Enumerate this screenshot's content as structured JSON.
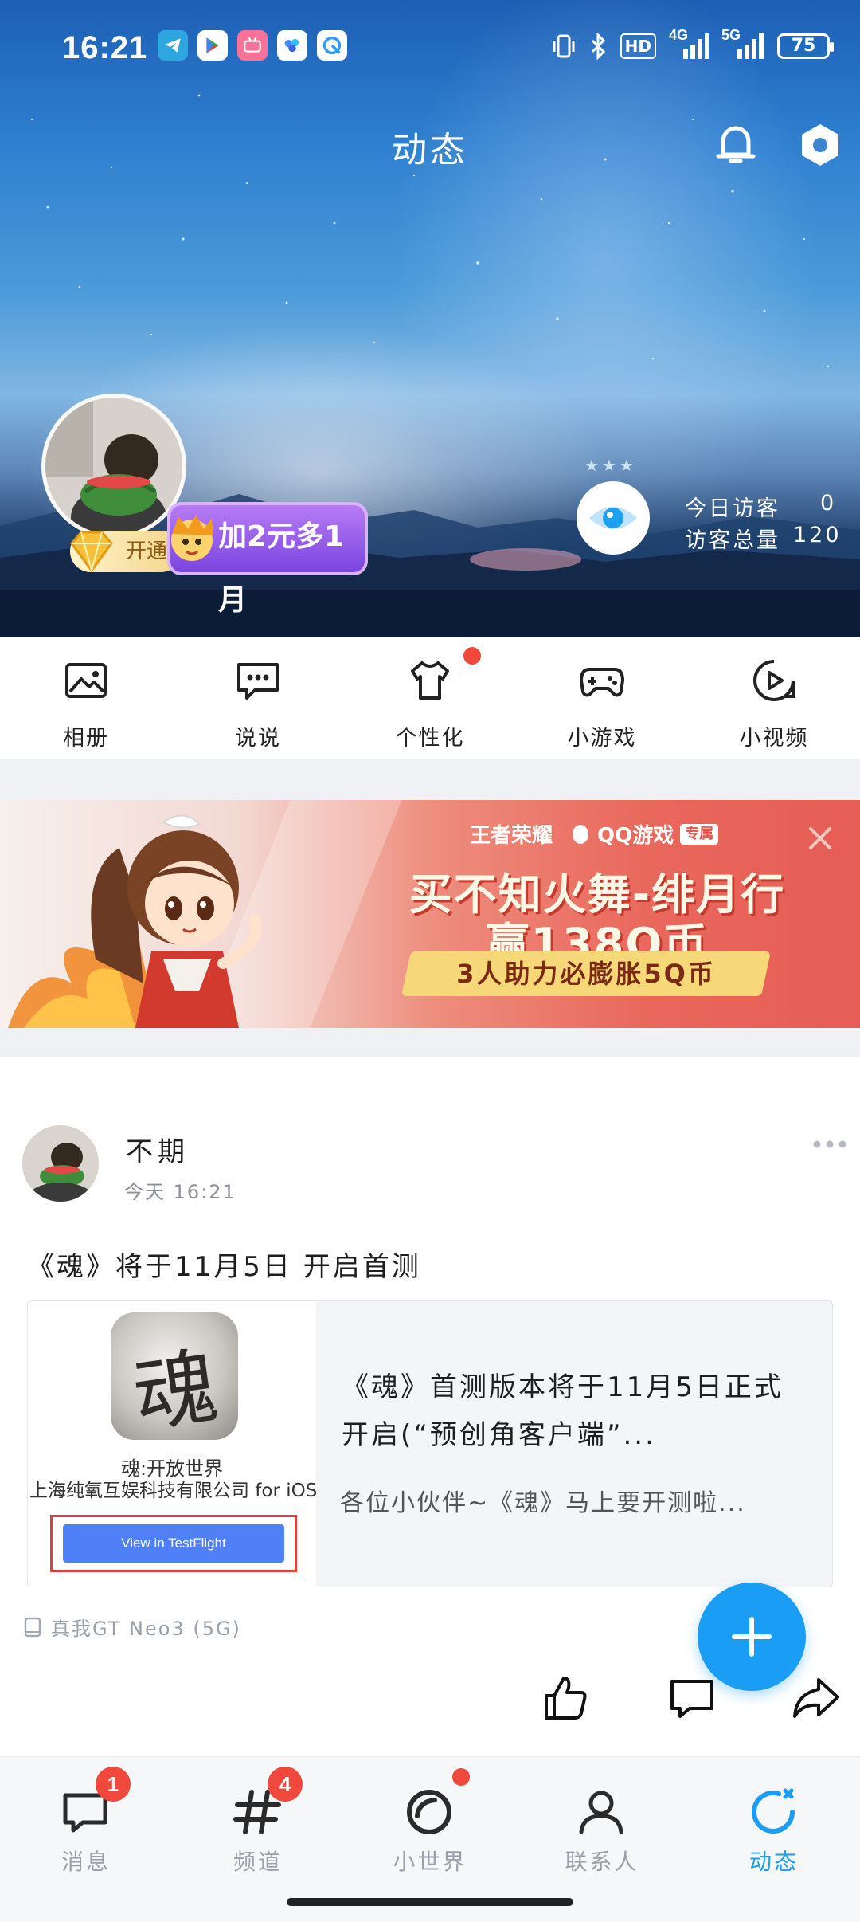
{
  "status_bar": {
    "time": "16:21",
    "apps": [
      "telegram-icon",
      "play-store-icon",
      "bilibili-icon",
      "baidu-netdisk-icon",
      "qq-browser-icon"
    ],
    "signal_4g": "4G",
    "signal_5g": "5G",
    "hd": "HD",
    "battery": "75"
  },
  "header": {
    "title": "动态",
    "bell_icon": "bell-icon",
    "settings_icon": "settings-icon"
  },
  "profile": {
    "vip_open_label": "开通",
    "vip_promo_label": "加2元多1月",
    "visitors_today_label": "今日访客",
    "visitors_today_value": "0",
    "visitors_total_label": "访客总量",
    "visitors_total_value": "120"
  },
  "quick_actions": [
    {
      "label": "相册",
      "icon": "photo-album-icon"
    },
    {
      "label": "说说",
      "icon": "chat-dots-icon"
    },
    {
      "label": "个性化",
      "icon": "tshirt-icon",
      "dot": true
    },
    {
      "label": "小游戏",
      "icon": "gamepad-icon"
    },
    {
      "label": "小视频",
      "icon": "video-play-icon"
    }
  ],
  "banner": {
    "brand_1": "王者荣耀",
    "brand_2": "QQ游戏",
    "brand_tag": "专属",
    "headline_1": "买不知火舞-绯月行",
    "headline_2": "赢138Q币",
    "subline": "3人助力必膨胀5Q币"
  },
  "post": {
    "author": "不期",
    "time": "今天 16:21",
    "text": "《魂》将于11月5日 开启首测",
    "card": {
      "app_name": "魂:开放世界",
      "company": "上海纯氧互娱科技有限公司 for iOS",
      "button": "View in TestFlight",
      "icon_char": "魂",
      "title": "《魂》首测版本将于11月5日正式开启(“预创角客户端”...",
      "desc": "各位小伙伴~《魂》马上要开测啦..."
    },
    "device": "真我GT Neo3 (5G)"
  },
  "bottom_nav": [
    {
      "label": "消息",
      "badge": "1",
      "active": false
    },
    {
      "label": "频道",
      "badge": "4",
      "active": false
    },
    {
      "label": "小世界",
      "dot": true,
      "active": false
    },
    {
      "label": "联系人",
      "active": false
    },
    {
      "label": "动态",
      "active": true
    }
  ],
  "colors": {
    "accent": "#1a9ef5",
    "badge_red": "#f0483c",
    "vip_purple": "#8a4fe8",
    "banner_red": "#e9685c"
  }
}
